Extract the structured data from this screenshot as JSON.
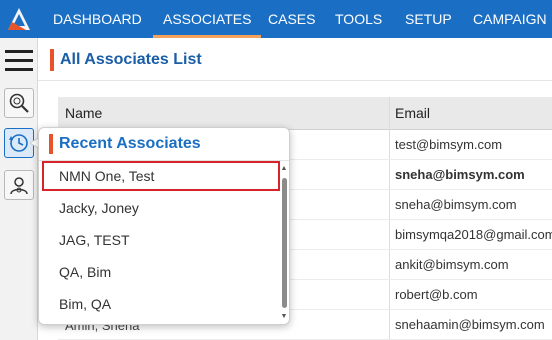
{
  "nav": {
    "items": [
      {
        "label": "DASHBOARD"
      },
      {
        "label": "ASSOCIATES"
      },
      {
        "label": "CASES"
      },
      {
        "label": "TOOLS"
      },
      {
        "label": "SETUP"
      },
      {
        "label": "CAMPAIGN"
      }
    ],
    "active": "ASSOCIATES"
  },
  "rail": {
    "icons": [
      "menu-icon",
      "search-icon",
      "history-icon",
      "person-icon"
    ]
  },
  "page": {
    "title": "All Associates List"
  },
  "table": {
    "headers": {
      "name": "Name",
      "email": "Email"
    },
    "rows": [
      {
        "name": "",
        "email": "test@bimsym.com",
        "bold": false
      },
      {
        "name": "",
        "email": "sneha@bimsym.com",
        "bold": true
      },
      {
        "name": "",
        "email": "sneha@bimsym.com",
        "bold": false
      },
      {
        "name": "",
        "email": "bimsymqa2018@gmail.com",
        "bold": false
      },
      {
        "name": "",
        "email": "ankit@bimsym.com",
        "bold": false
      },
      {
        "name": "",
        "email": "robert@b.com",
        "bold": false
      },
      {
        "name": "Amin, Sneha",
        "email": "snehaamin@bimsym.com",
        "bold": false
      }
    ]
  },
  "recent": {
    "title": "Recent Associates",
    "items": [
      {
        "label": "NMN One, Test",
        "highlighted": true
      },
      {
        "label": "Jacky, Joney",
        "highlighted": false
      },
      {
        "label": "JAG, TEST",
        "highlighted": false
      },
      {
        "label": "QA, Bim",
        "highlighted": false
      },
      {
        "label": "Bim, QA",
        "highlighted": false
      }
    ]
  },
  "colors": {
    "nav_bg": "#1a6fc4",
    "accent": "#e8542a",
    "highlight_border": "#d8232a"
  }
}
